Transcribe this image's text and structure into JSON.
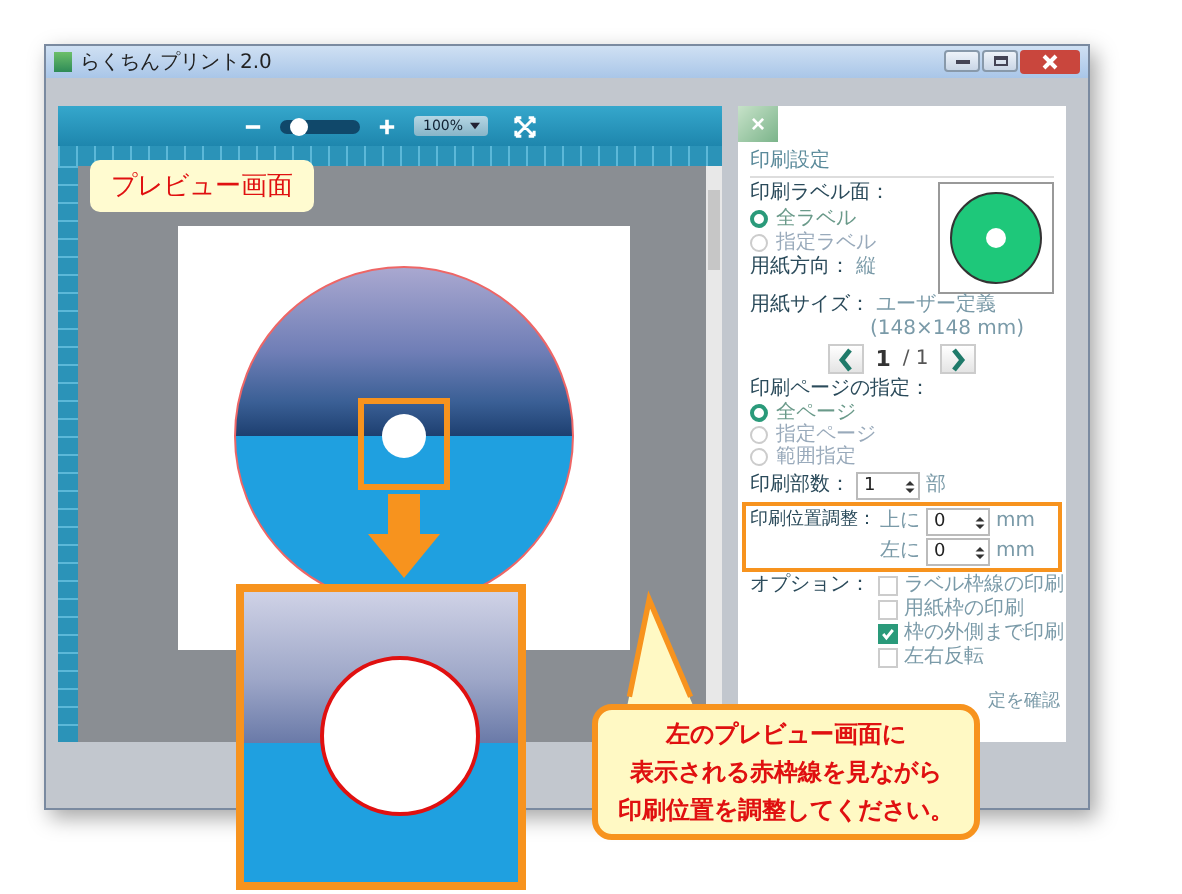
{
  "window": {
    "title": "らくちんプリント2.0"
  },
  "toolbar": {
    "zoom_slider": {
      "level": 0.15
    },
    "zoom_select": "100%"
  },
  "preview": {
    "label": "プレビュー画面"
  },
  "settings": {
    "close": "×",
    "heading": "印刷設定",
    "label_side": {
      "label": "印刷ラベル面：",
      "options": [
        {
          "label": "全ラベル",
          "selected": true
        },
        {
          "label": "指定ラベル",
          "selected": false
        }
      ]
    },
    "orientation": {
      "label": "用紙方向：",
      "value": "縦"
    },
    "paper_size": {
      "label": "用紙サイズ：",
      "value": "ユーザー定義",
      "detail": "(148×148 mm)"
    },
    "pager": {
      "current": "1",
      "total": "/ 1"
    },
    "pages": {
      "label": "印刷ページの指定：",
      "options": [
        {
          "label": "全ページ",
          "selected": true
        },
        {
          "label": "指定ページ",
          "selected": false
        },
        {
          "label": "範囲指定",
          "selected": false
        }
      ]
    },
    "copies": {
      "label": "印刷部数：",
      "value": "1",
      "unit": "部"
    },
    "position": {
      "label": "印刷位置調整：",
      "rows": [
        {
          "label": "上に",
          "value": "0",
          "unit": "mm"
        },
        {
          "label": "左に",
          "value": "0",
          "unit": "mm"
        }
      ]
    },
    "options": {
      "label": "オプション：",
      "items": [
        {
          "label": "ラベル枠線の印刷",
          "checked": false
        },
        {
          "label": "用紙枠の印刷",
          "checked": false
        },
        {
          "label": "枠の外側まで印刷",
          "checked": true
        },
        {
          "label": "左右反転",
          "checked": false
        }
      ]
    },
    "confirm_link": "定を確認"
  },
  "callout": {
    "lines": [
      "左のプレビュー画面に",
      "表示される赤枠線を見ながら",
      "印刷位置を調整してください。"
    ]
  }
}
